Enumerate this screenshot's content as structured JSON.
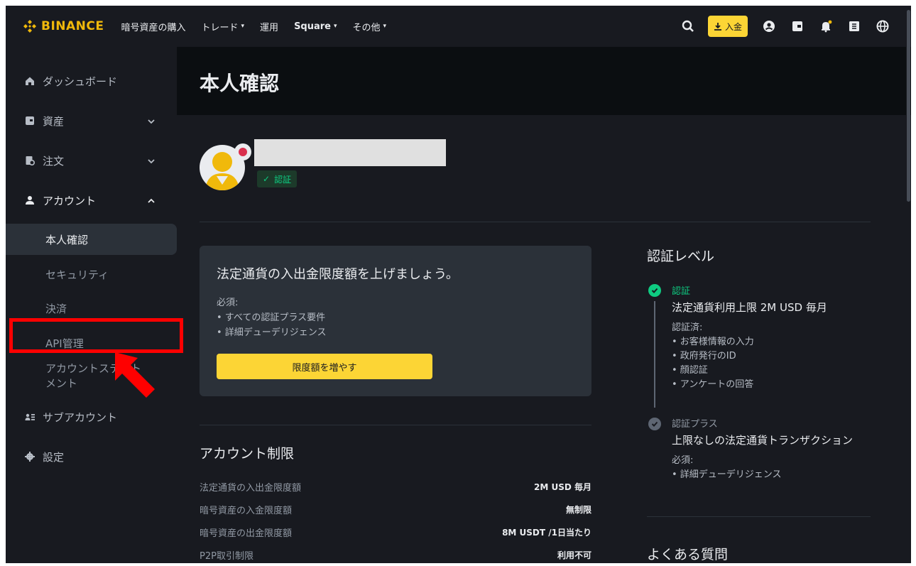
{
  "header": {
    "brand": "BINANCE",
    "nav": [
      {
        "label": "暗号資産の購入",
        "caret": false,
        "bold": false
      },
      {
        "label": "トレード",
        "caret": true,
        "bold": false
      },
      {
        "label": "運用",
        "caret": false,
        "bold": false
      },
      {
        "label": "Square",
        "caret": true,
        "bold": true
      },
      {
        "label": "その他",
        "caret": true,
        "bold": false
      }
    ],
    "deposit_label": "入金",
    "icons": [
      "search-icon",
      "profile-icon",
      "wallet-icon",
      "notification-bell-icon",
      "download-app-icon",
      "globe-icon"
    ]
  },
  "sidebar": {
    "items": [
      {
        "label": "ダッシュボード",
        "icon": "home-icon"
      },
      {
        "label": "資産",
        "icon": "asset-icon",
        "chevron": "down"
      },
      {
        "label": "注文",
        "icon": "orders-icon",
        "chevron": "down"
      },
      {
        "label": "アカウント",
        "icon": "person-icon",
        "chevron": "up"
      },
      {
        "label": "サブアカウント",
        "icon": "sub-account-icon"
      },
      {
        "label": "設定",
        "icon": "gear-icon"
      }
    ],
    "account_sub": [
      {
        "label": "本人確認",
        "active": true
      },
      {
        "label": "セキュリティ"
      },
      {
        "label": "決済"
      },
      {
        "label": "API管理"
      },
      {
        "label": "アカウントステートメント"
      }
    ]
  },
  "page": {
    "title": "本人確認",
    "verified_label": "認証"
  },
  "promo": {
    "title": "法定通貨の入出金限度額を上げましょう。",
    "required_label": "必須:",
    "requirements": [
      "• すべての認証プラス要件",
      "• 詳細デューデリジェンス"
    ],
    "button_label": "限度額を増やす"
  },
  "limits": {
    "title": "アカウント制限",
    "rows": [
      {
        "label": "法定通貨の入出金限度額",
        "value": "2M USD 毎月"
      },
      {
        "label": "暗号資産の入金限度額",
        "value": "無制限"
      },
      {
        "label": "暗号資産の出金限度額",
        "value": "8M USDT /1日当たり"
      },
      {
        "label": "P2P取引制限",
        "value": "利用不可"
      }
    ]
  },
  "levels": {
    "title": "認証レベル",
    "verified": {
      "name": "認証",
      "description": "法定通貨利用上限 2M USD 毎月",
      "list_title": "認証済:",
      "list": [
        "• お客様情報の入力",
        "• 政府発行のID",
        "• 顔認証",
        "• アンケートの回答"
      ]
    },
    "plus": {
      "name": "認証プラス",
      "description": "上限なしの法定通貨トランザクション",
      "list_title": "必須:",
      "list": [
        "• 詳細デューデリジェンス"
      ]
    }
  },
  "faq": {
    "title": "よくある質問"
  },
  "colors": {
    "brand_yellow": "#F0B90B",
    "button_yellow": "#FCD535",
    "success_green": "#0ECB81",
    "background": "#181A20",
    "card": "#2B3139",
    "annotation_red": "#FF0000"
  }
}
